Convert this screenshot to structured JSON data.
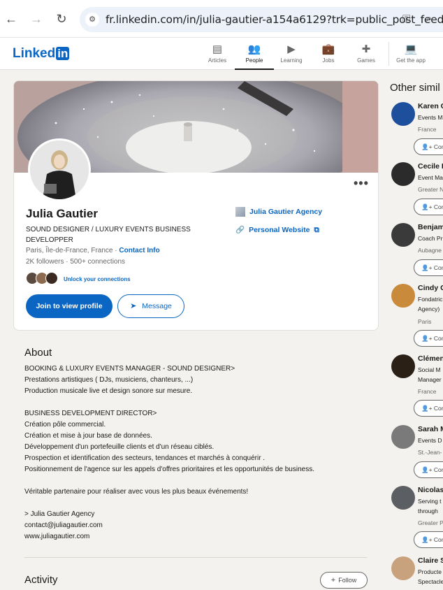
{
  "browser": {
    "back": "←",
    "forward": "→",
    "reload": "↻",
    "url": "fr.linkedin.com/in/julia-gautier-a154a6129?trk=public_post_feed-...",
    "site_icon": "tune-icon",
    "key_icon": "key-icon",
    "zoom_icon": "zoom-icon"
  },
  "header": {
    "logo_text": "Linked",
    "logo_in": "in",
    "nav": [
      {
        "label": "Articles",
        "icon": "▤"
      },
      {
        "label": "People",
        "icon": "👥"
      },
      {
        "label": "Learning",
        "icon": "▶"
      },
      {
        "label": "Jobs",
        "icon": "💼"
      },
      {
        "label": "Games",
        "icon": "✚"
      },
      {
        "label": "Get the app",
        "icon": "💻"
      }
    ]
  },
  "profile": {
    "name": "Julia Gautier",
    "headline": "SOUND DESIGNER / LUXURY EVENTS BUSINESS DEVELOPPER",
    "location": "Paris, Île-de-France, France",
    "separator": "·",
    "contact_info": "Contact Info",
    "followers": "2K followers",
    "connections": "500+ connections",
    "unlock": "Unlock your connections",
    "join_button": "Join to view profile",
    "message_button": "Message",
    "more": "•••",
    "agency": "Julia Gautier Agency",
    "website": "Personal Website",
    "external_icon": "⧉"
  },
  "about": {
    "title": "About",
    "text": "BOOKING & LUXURY EVENTS MANAGER - SOUND DESIGNER>\nPrestations artistiques ( DJs, musiciens, chanteurs, ...)\nProduction musicale live et design sonore sur mesure.\n\nBUSINESS DEVELOPMENT DIRECTOR>\nCréation pôle commercial.\nCréation et mise à jour base de données.\nDéveloppement d'un portefeuille clients et d'un réseau ciblés.\nProspection et identification des secteurs, tendances et marchés à conquérir .\nPositionnement de l'agence sur les appels d'offres prioritaires et les opportunités de business.\n\nVéritable partenaire pour réaliser avec vous les plus beaux événements!\n\n> Julia Gautier Agency\ncontact@juliagautier.com\nwww.juliagautier.com"
  },
  "activity": {
    "title": "Activity",
    "follow_button": "Follow",
    "follow_icon": "+"
  },
  "sidebar": {
    "title": "Other simil",
    "connect_label": "Con",
    "people": [
      {
        "name": "Karen C",
        "line1": "Events M",
        "line2": "",
        "location": "France",
        "color": "#1e4f9c"
      },
      {
        "name": "Cecile L",
        "line1": "Event Ma",
        "line2": "",
        "location": "Greater N",
        "color": "#2b2b2b"
      },
      {
        "name": "Benjam",
        "line1": "Coach Pr",
        "line2": "",
        "location": "Aubagne",
        "color": "#3a3a3a"
      },
      {
        "name": "Cindy G",
        "line1": "Fondatric",
        "line2": "Agency)",
        "location": "Paris",
        "color": "#c98a3b"
      },
      {
        "name": "Clémen",
        "line1": "Social M",
        "line2": "Manager",
        "location": "France",
        "color": "#2a2016"
      },
      {
        "name": "Sarah M",
        "line1": "Events D",
        "line2": "",
        "location": "St.-Jean-",
        "color": "#7a7a7a"
      },
      {
        "name": "Nicolas",
        "line1": "Serving t",
        "line2": "through",
        "location": "Greater P",
        "color": "#5b5f63"
      },
      {
        "name": "Claire S",
        "line1": "Producte",
        "line2": "Spectacle",
        "location": "",
        "color": "#c7a27c"
      }
    ]
  }
}
